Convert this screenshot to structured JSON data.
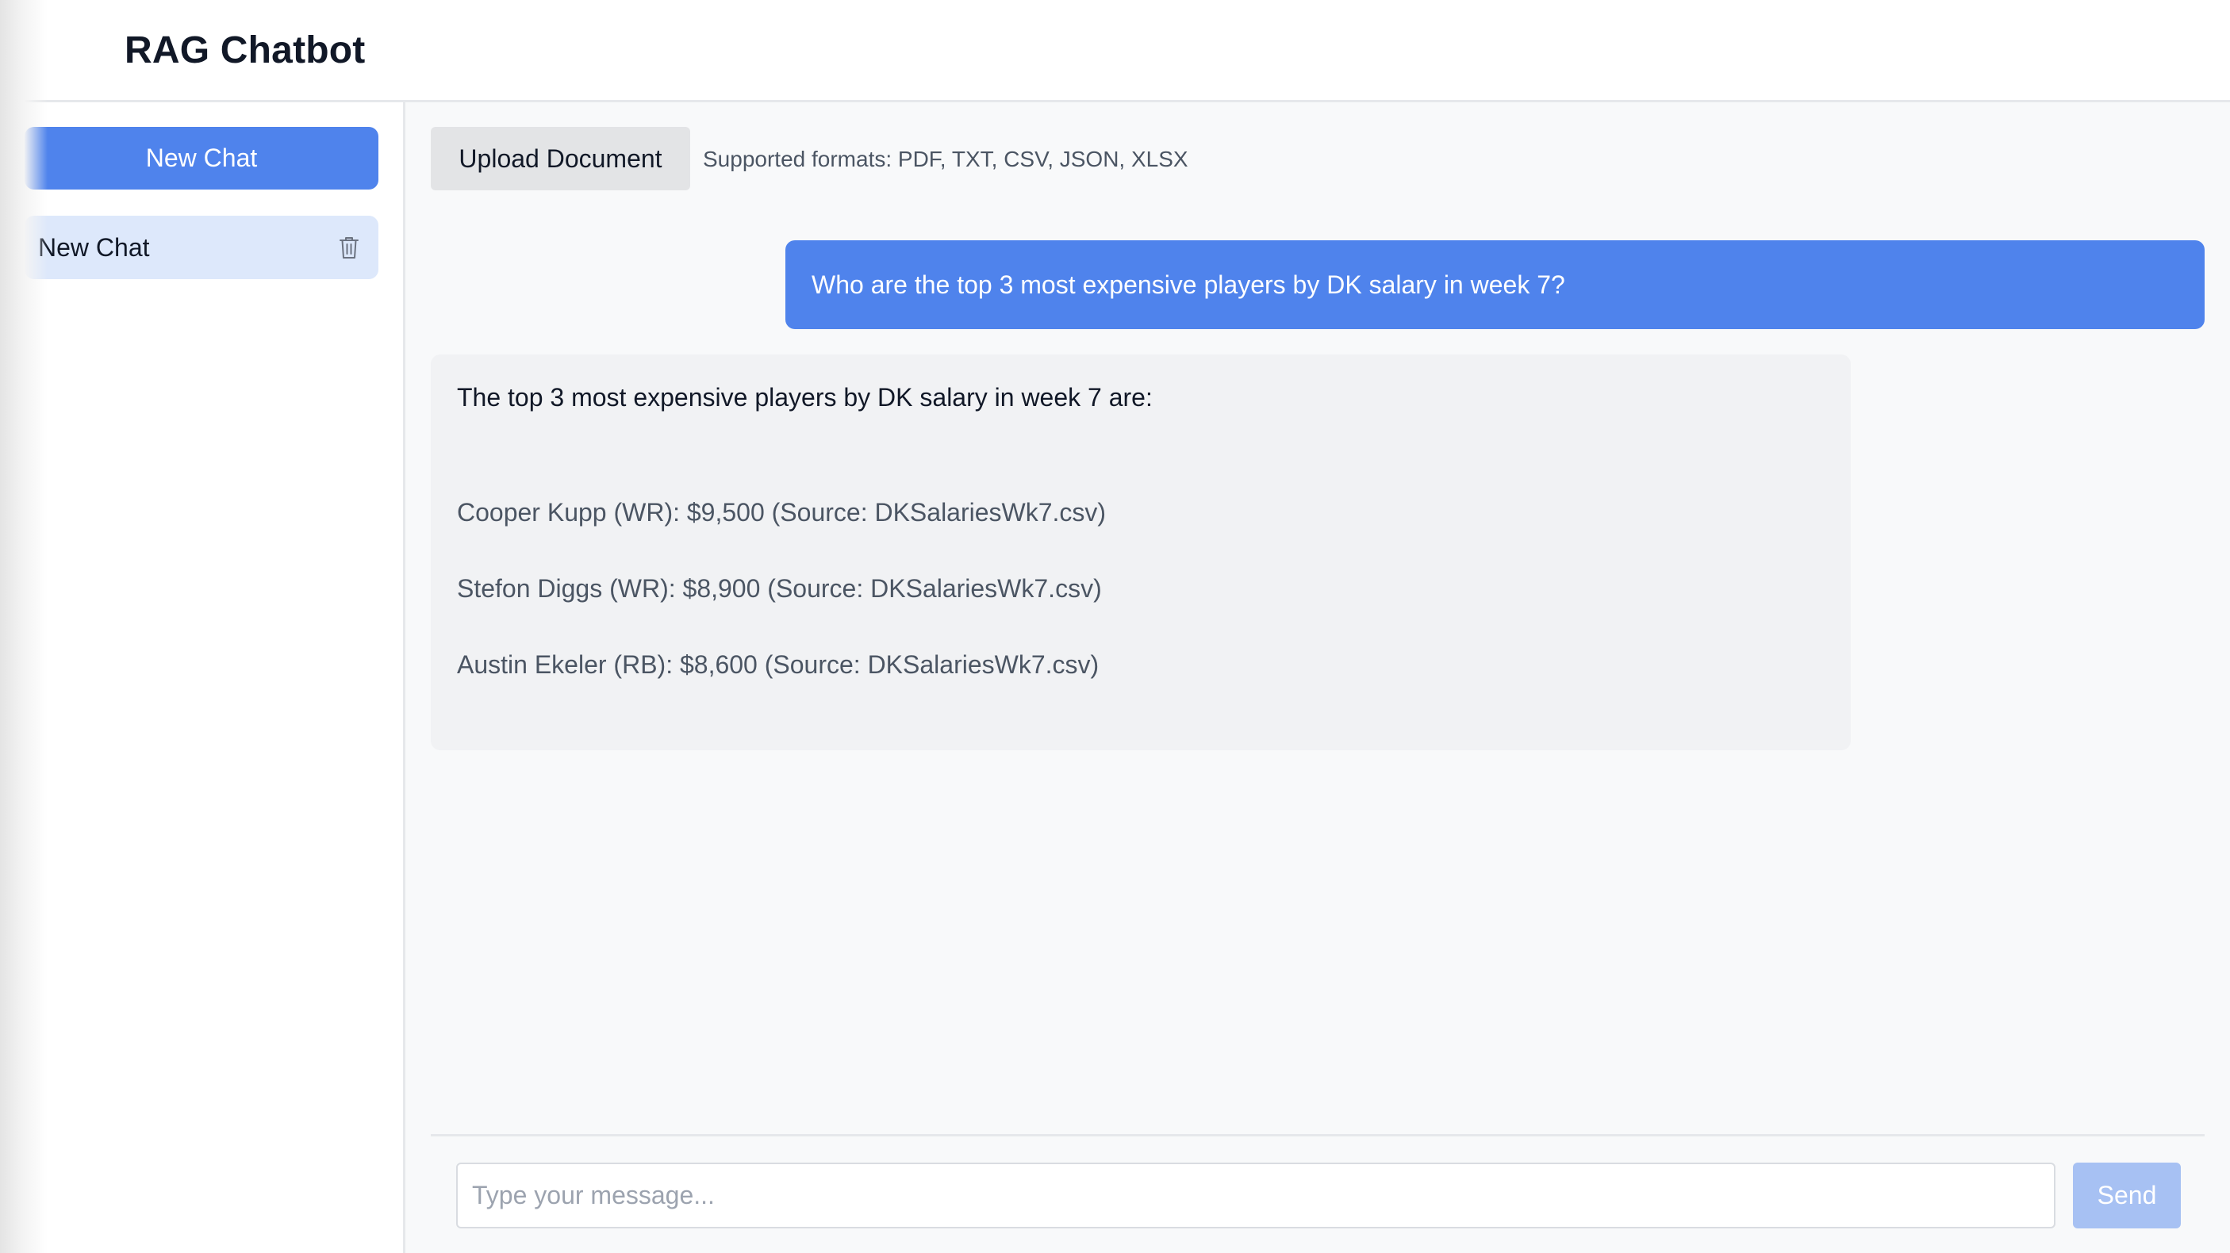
{
  "app": {
    "title": "RAG Chatbot"
  },
  "sidebar": {
    "new_chat_label": "New Chat",
    "chats": [
      {
        "label": "New Chat",
        "icon": "trash-icon"
      }
    ]
  },
  "toolbar": {
    "upload_label": "Upload Document",
    "supported_formats": "Supported formats: PDF, TXT, CSV, JSON, XLSX"
  },
  "conversation": {
    "user_message": "Who are the top 3 most expensive players by DK salary in week 7?",
    "assistant_intro": "The top 3 most expensive players by DK salary in week 7 are:",
    "assistant_lines": [
      "Cooper Kupp (WR): $9,500 (Source: DKSalariesWk7.csv)",
      "Stefon Diggs (WR): $8,900 (Source: DKSalariesWk7.csv)",
      "Austin Ekeler (RB): $8,600 (Source: DKSalariesWk7.csv)"
    ]
  },
  "composer": {
    "placeholder": "Type your message...",
    "value": "",
    "send_label": "Send"
  },
  "colors": {
    "accent": "#4f83ec",
    "accent_disabled": "#a7c1f3",
    "selected_chat_bg": "#dde8fb",
    "assistant_bubble_bg": "#f1f2f4",
    "main_bg": "#f8f9fa"
  }
}
